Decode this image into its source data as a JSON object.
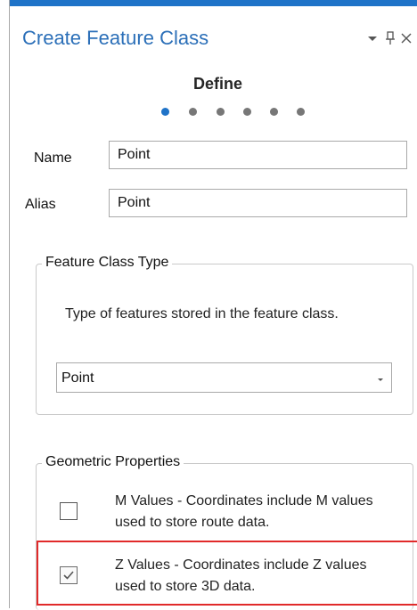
{
  "panel": {
    "title": "Create Feature Class",
    "controls": {
      "menu_icon": "chevron-down-icon",
      "pin_icon": "pin-icon",
      "close_icon": "close-icon"
    }
  },
  "wizard": {
    "step_title": "Define",
    "step_count": 6,
    "current_step": 1
  },
  "fields": {
    "name_label": "Name",
    "name_value": "Point",
    "alias_label": "Alias",
    "alias_value": "Point"
  },
  "feature_class_type": {
    "legend": "Feature Class Type",
    "description": "Type of features stored in the feature class.",
    "selected": "Point"
  },
  "geometric_properties": {
    "legend": "Geometric Properties",
    "m_values": {
      "label": "M Values - Coordinates include M values used to store route data.",
      "checked": false
    },
    "z_values": {
      "label": "Z Values - Coordinates include Z values used to store 3D data.",
      "checked": true
    }
  },
  "colors": {
    "accent": "#1f73c8",
    "title": "#2b6fb8",
    "highlight": "#e12a2a"
  }
}
